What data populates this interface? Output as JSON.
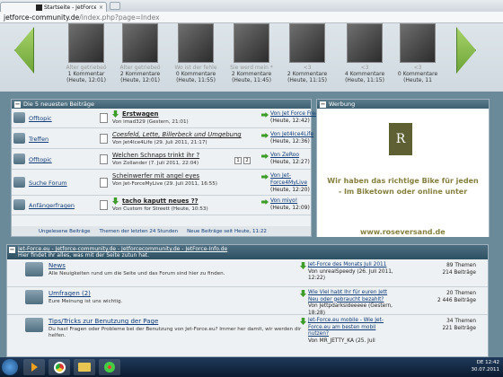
{
  "browser": {
    "tab_title": "Startseite - JetForce/Jet-For",
    "url_host": "jetforce-community.de",
    "url_path": "/index.php?page=Index"
  },
  "gallery": [
    {
      "caption": "Alter getriebeö",
      "comments": "1 Kommentar",
      "date": "(Heute, 12:01)"
    },
    {
      "caption": "Alter getriebeö",
      "comments": "2 Kommentare",
      "date": "(Heute, 12:01)"
    },
    {
      "caption": "Wo ist der fehle",
      "comments": "0 Kommentare",
      "date": "(Heute, 11:55)"
    },
    {
      "caption": "Sie werd mein *",
      "comments": "2 Kommentare",
      "date": "(Heute, 11:45)"
    },
    {
      "caption": "<3",
      "comments": "2 Kommentare",
      "date": "(Heute, 11:15)"
    },
    {
      "caption": "<3",
      "comments": "4 Kommentare",
      "date": "(Heute, 11:15)"
    },
    {
      "caption": "<3",
      "comments": "0 Kommentare",
      "date": "(Heute, 11"
    }
  ],
  "latest": {
    "title": "Die 5 neuesten Beiträge",
    "rows": [
      {
        "forum": "Offtopic",
        "thread": "Erstwagen",
        "meta": "Von imad329 (Gestern, 21:01)",
        "by": "Von Jet Force Freak",
        "when": "(Heute, 12:42)",
        "bold": true
      },
      {
        "forum": "Treffen",
        "thread": "Coesfeld, Lette, Billerbeck und Umgebung",
        "meta": "Von Jet4Ice4Life (29. Juli 2011, 21:17)",
        "by": "Von Jet4Ice4Life",
        "when": "(Heute, 12:36)",
        "bold": false
      },
      {
        "forum": "Offtopic",
        "thread": "Welchen Schnaps trinkt ihr ?",
        "meta": "Von Zollander (7. Juli 2011, 22:04)",
        "by": "Von ZeRoo",
        "when": "(Heute, 12:27)",
        "bold": false
      },
      {
        "forum": "Suche Forum",
        "thread": "Scheinwerfer mit angel eyes",
        "meta": "Von Jet-ForceMyLive (29. Juli 2011, 16:55)",
        "by": "Von Jet-Force4MyLive",
        "when": "(Heute, 12:20)",
        "bold": false
      },
      {
        "forum": "Anfängerfragen",
        "thread": "tacho kaputt neues ??",
        "meta": "Von Custom for Streett (Heute, 10:53)",
        "by": "Von miyo!",
        "when": "(Heute, 12:09)",
        "bold": true
      }
    ],
    "pages": [
      "1",
      "2"
    ],
    "footer": [
      "Ungelesene Beiträge",
      "Themen der letzten 24 Stunden",
      "Neue Beiträge seit Heute, 11:22"
    ]
  },
  "ad": {
    "title": "Werbung",
    "logo_letter": "R",
    "line1": "Wir haben das richtige Bike für jeden",
    "line2": "-  Im Biketown oder online unter",
    "url": "www.roseversand.de"
  },
  "forums": {
    "header": "Jet-Force.eu - Jetforce-community.de - Jetforcecommunity.de - JetForce-Info.de",
    "subheader": "Hier findet ihr alles, was mit der Seite zutun hat.",
    "rows": [
      {
        "name": "News",
        "desc": "Alle Neuigkeiten rund um die Seite und das Forum sind hier zu finden.",
        "last_title": "Jet-Force des Monats Juli 2011",
        "last_by": "Von unrealSpeedy",
        "last_when": "(26. Juli 2011, 12:22)",
        "threads": "89 Themen",
        "posts": "214 Beiträge"
      },
      {
        "name": "Umfragen (2)",
        "desc": "Eure Meinung ist uns wichtig.",
        "last_title": "Wie Viel habt Ihr für euren Jett Neu oder gebraucht bezahlt?",
        "last_by": "Von Jettpdarksideeeee",
        "last_when": "(Gestern, 18:28)",
        "threads": "20 Themen",
        "posts": "2 446 Beiträge"
      },
      {
        "name": "Tips/Tricks zur Benutzung der Page",
        "desc": "Du hast Fragen oder Probleme bei der Benutzung von Jet-Force.eu? Immer her damit, wir werden dir helfen.",
        "last_title": "Jet-Force.eu mobile - Wie Jet-Force.eu am besten mobil nutzen?",
        "last_by": "Von MR_JETTY_KA",
        "last_when": "(25. Juli",
        "threads": "34 Themen",
        "posts": "221 Beiträge"
      }
    ]
  },
  "tray": {
    "lang": "DE",
    "time": "12:42",
    "date": "30.07.2011"
  }
}
